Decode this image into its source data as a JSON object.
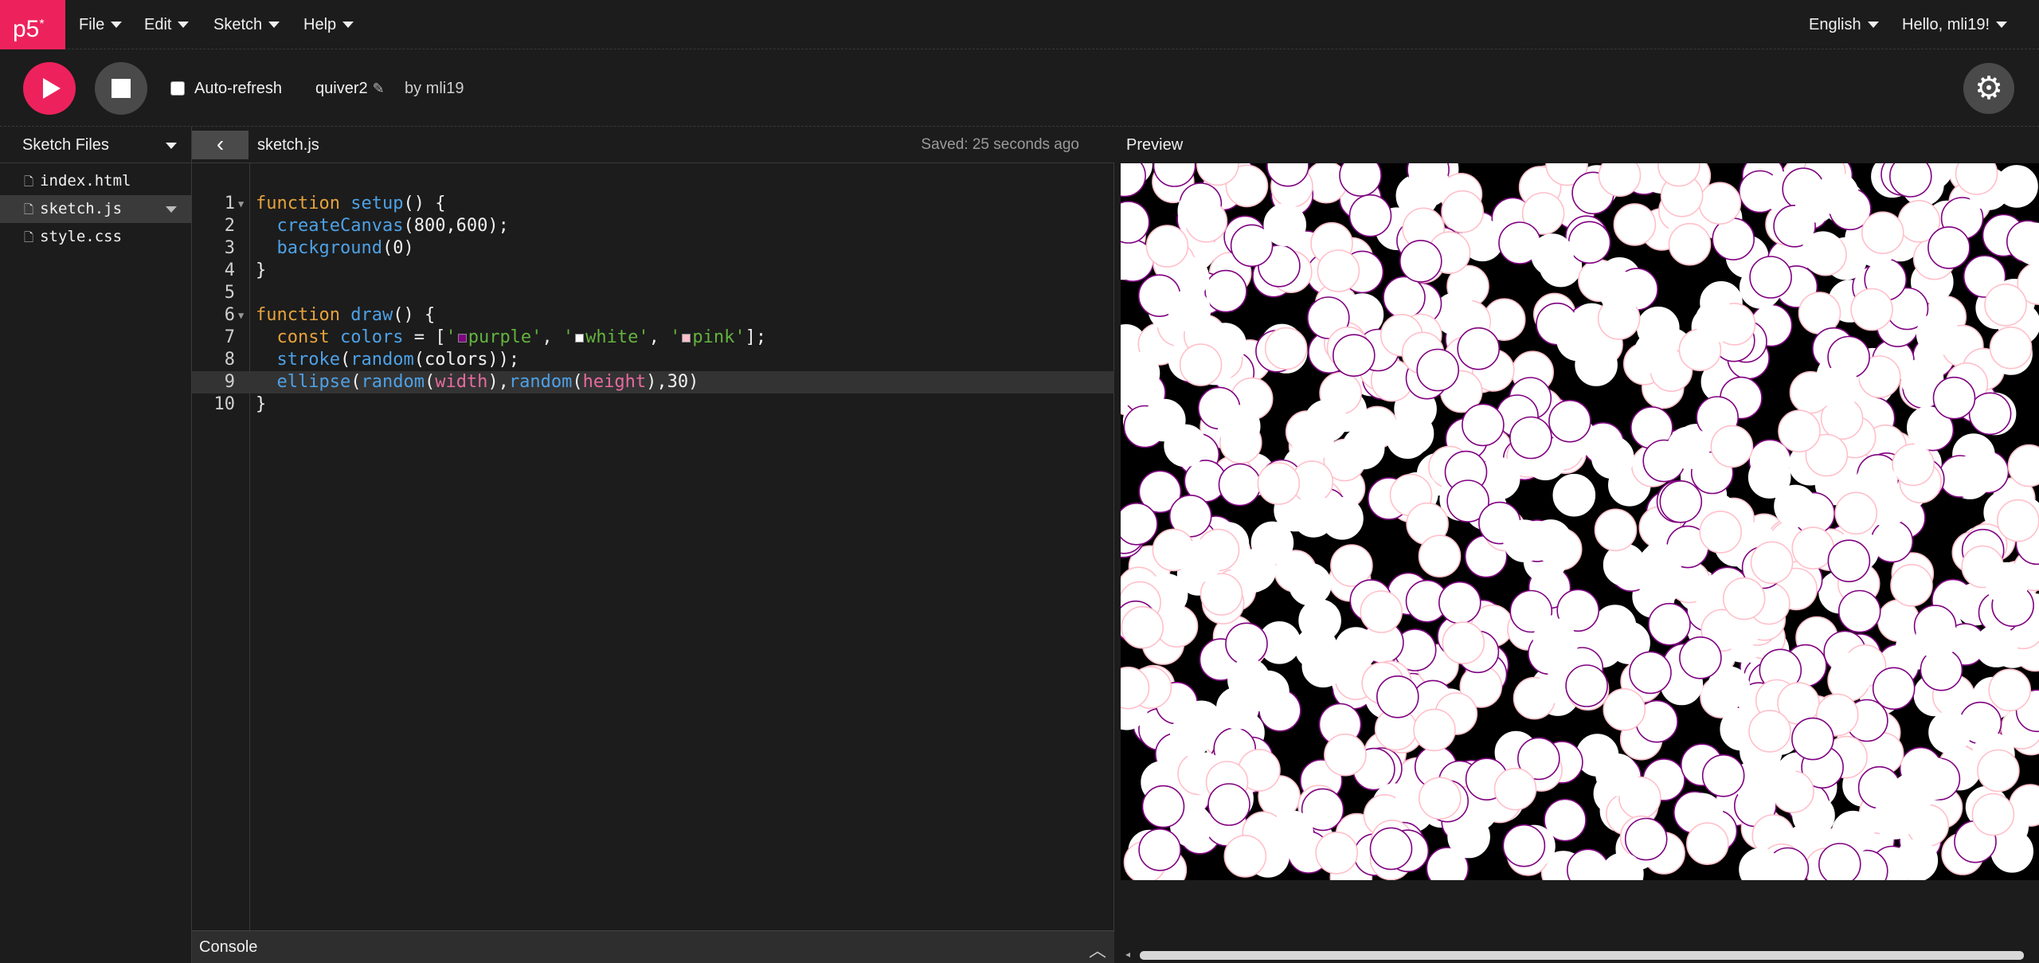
{
  "app": {
    "logo": "p5",
    "logo_sup": "*"
  },
  "nav": {
    "file": "File",
    "edit": "Edit",
    "sketch": "Sketch",
    "help": "Help",
    "language": "English",
    "user": "Hello, mli19!"
  },
  "toolbar": {
    "auto_refresh": "Auto-refresh",
    "sketch_name": "quiver2",
    "by": "by mli19"
  },
  "sidebar": {
    "header": "Sketch Files",
    "files": [
      "index.html",
      "sketch.js",
      "style.css"
    ],
    "active_file": "sketch.js"
  },
  "editor": {
    "tab": "sketch.js",
    "saved": "Saved: 25 seconds ago",
    "current_line": 9,
    "lines": [
      {
        "n": "1",
        "text": "function setup() {"
      },
      {
        "n": "2",
        "text": "  createCanvas(800,600);"
      },
      {
        "n": "3",
        "text": "  background(0)"
      },
      {
        "n": "4",
        "text": "}"
      },
      {
        "n": "5",
        "text": ""
      },
      {
        "n": "6",
        "text": "function draw() {"
      },
      {
        "n": "7",
        "text": "  const colors = ['purple', 'white', 'pink'];"
      },
      {
        "n": "8",
        "text": "  stroke(random(colors));"
      },
      {
        "n": "9",
        "text": "  ellipse(random(width),random(height),30)"
      },
      {
        "n": "10",
        "text": "}"
      }
    ]
  },
  "console": {
    "label": "Console"
  },
  "preview": {
    "label": "Preview",
    "background": "#000000",
    "fill": "#ffffff",
    "stroke_colors": [
      "#800080",
      "#ffffff",
      "#ffc0cb"
    ]
  },
  "colors": {
    "accent": "#ed225d",
    "background": "#1c1c1c",
    "keyword": "#e6a23c",
    "function": "#4ea1e6",
    "string": "#63b33e",
    "builtin_var": "#e86a9e"
  }
}
